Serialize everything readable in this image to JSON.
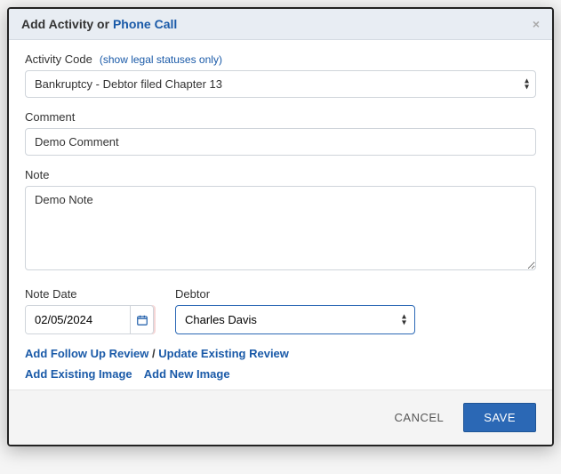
{
  "header": {
    "title_prefix": "Add Activity or ",
    "title_link": "Phone Call"
  },
  "activity_code": {
    "label": "Activity Code",
    "hint": "(show legal statuses only)",
    "value": "Bankruptcy - Debtor filed Chapter 13"
  },
  "comment": {
    "label": "Comment",
    "value": "Demo Comment"
  },
  "note": {
    "label": "Note",
    "value": "Demo Note"
  },
  "note_date": {
    "label": "Note Date",
    "value": "02/05/2024"
  },
  "debtor": {
    "label": "Debtor",
    "value": "Charles Davis"
  },
  "links": {
    "add_follow_up": "Add Follow Up Review",
    "update_review": "Update Existing Review",
    "sep": " / ",
    "add_existing_image": "Add Existing Image",
    "add_new_image": "Add New Image"
  },
  "footer": {
    "cancel": "CANCEL",
    "save": "SAVE"
  }
}
